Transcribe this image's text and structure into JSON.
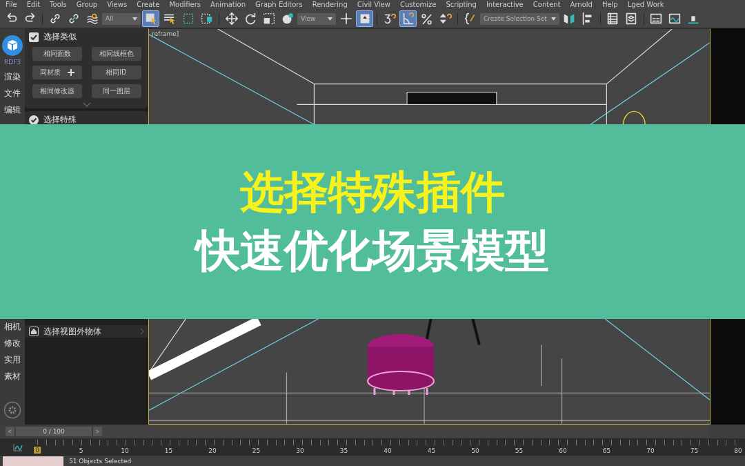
{
  "menu": [
    "File",
    "Edit",
    "Tools",
    "Group",
    "Views",
    "Create",
    "Modifiers",
    "Animation",
    "Graph Editors",
    "Rendering",
    "Civil View",
    "Customize",
    "Scripting",
    "Interactive",
    "Content",
    "Arnold",
    "Help",
    "Lged Work"
  ],
  "toolbar": [
    {
      "kind": "tool",
      "selected": false
    },
    {
      "kind": "tool",
      "selected": false
    },
    {
      "kind": "sep"
    },
    {
      "kind": "tool",
      "selected": false
    },
    {
      "kind": "tool",
      "selected": false
    },
    {
      "kind": "tool",
      "selected": false
    },
    {
      "kind": "dropdown",
      "value": "All"
    },
    {
      "kind": "tool",
      "selected": true
    },
    {
      "kind": "tool",
      "selected": false
    },
    {
      "kind": "tool",
      "selected": false
    },
    {
      "kind": "tool",
      "selected": false
    },
    {
      "kind": "sep"
    },
    {
      "kind": "tool",
      "selected": false
    },
    {
      "kind": "tool",
      "selected": false
    },
    {
      "kind": "tool",
      "selected": false
    },
    {
      "kind": "tool",
      "selected": false
    },
    {
      "kind": "dropdown",
      "value": "View"
    },
    {
      "kind": "tool",
      "selected": false
    },
    {
      "kind": "tool",
      "selected": true
    },
    {
      "kind": "sep"
    },
    {
      "kind": "tool",
      "selected": false
    },
    {
      "kind": "tool",
      "selected": true
    },
    {
      "kind": "tool",
      "selected": false
    },
    {
      "kind": "tool",
      "selected": false
    },
    {
      "kind": "sep"
    },
    {
      "kind": "tool",
      "selected": false
    },
    {
      "kind": "dropdown",
      "value": "Create Selection Set"
    },
    {
      "kind": "tool",
      "selected": false
    },
    {
      "kind": "tool",
      "selected": false
    },
    {
      "kind": "sep"
    },
    {
      "kind": "tool",
      "selected": false
    },
    {
      "kind": "tool",
      "selected": false
    },
    {
      "kind": "sep"
    },
    {
      "kind": "tool",
      "selected": false
    },
    {
      "kind": "tool",
      "selected": false
    },
    {
      "kind": "tool",
      "selected": false
    }
  ],
  "sidebar": {
    "logo_label": "RDF3",
    "top_items": [
      "渲染",
      "文件",
      "编辑"
    ],
    "bottom_items": [
      "相机",
      "修改",
      "实用",
      "素材"
    ]
  },
  "panel": {
    "sections": [
      {
        "title": "选择类似",
        "checked": true,
        "buttons": [
          {
            "label": "相同面数",
            "kind": "plain"
          },
          {
            "label": "相同线框色",
            "kind": "plain"
          },
          {
            "label": "同材质",
            "kind": "plus"
          },
          {
            "label": "相同ID",
            "kind": "plain"
          },
          {
            "label": "相同修改器",
            "kind": "plain"
          },
          {
            "label": "同一图层",
            "kind": "plain"
          }
        ]
      },
      {
        "title": "选择特殊",
        "checked": true
      }
    ],
    "bottom_row": "选择视图外物体"
  },
  "viewport": {
    "label": "reframe]"
  },
  "banner": {
    "line_1": "选择特殊插件",
    "line_2": "快速优化场景模型"
  },
  "timeline": {
    "position": "0 / 100",
    "level": 0,
    "prev": "<",
    "next": ">",
    "ticks": [
      "0",
      "5",
      "10",
      "15",
      "20",
      "25",
      "30",
      "35",
      "40",
      "45",
      "50",
      "55",
      "60",
      "65",
      "70",
      "75",
      "80"
    ]
  },
  "status": {
    "text": "51 Objects Selected"
  }
}
